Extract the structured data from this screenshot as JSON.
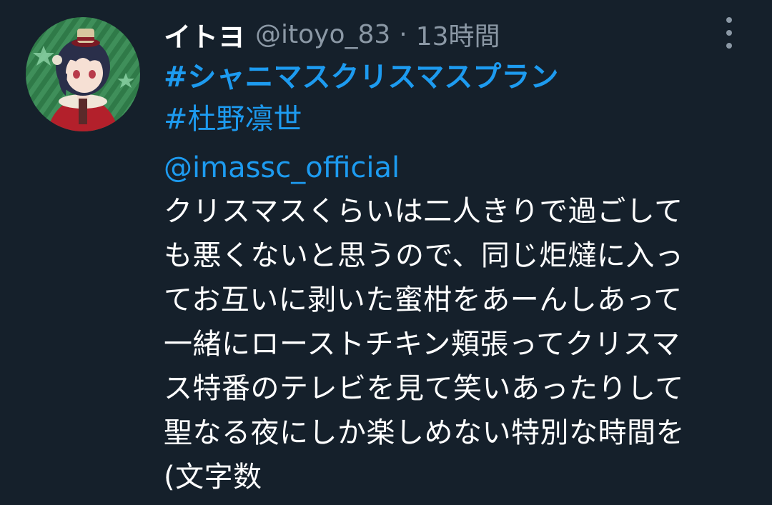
{
  "tweet": {
    "author": {
      "display_name": "イトヨ",
      "handle": "@itoyo_83",
      "avatar_icon": "avatar-character-illustration"
    },
    "separator": "·",
    "timestamp": "13時間",
    "more_icon": "more-vertical-icon",
    "hashtags": [
      "#シャニマスクリスマスプラン",
      "#杜野凛世"
    ],
    "mention": "@imassc_official",
    "content_lines": [
      "クリスマスくらいは二人きりで過ごして",
      "も悪くないと思うので、同じ炬燵に入っ",
      "てお互いに剥いた蜜柑をあーんしあって",
      "一緒にローストチキン頬張ってクリスマ",
      "ス特番のテレビを見て笑いあったりして",
      "聖なる夜にしか楽しめない特別な時間を",
      "(文字数"
    ]
  },
  "colors": {
    "background": "#15202b",
    "text": "#ffffff",
    "secondary_text": "#8b98a5",
    "link": "#1d9bf0"
  }
}
